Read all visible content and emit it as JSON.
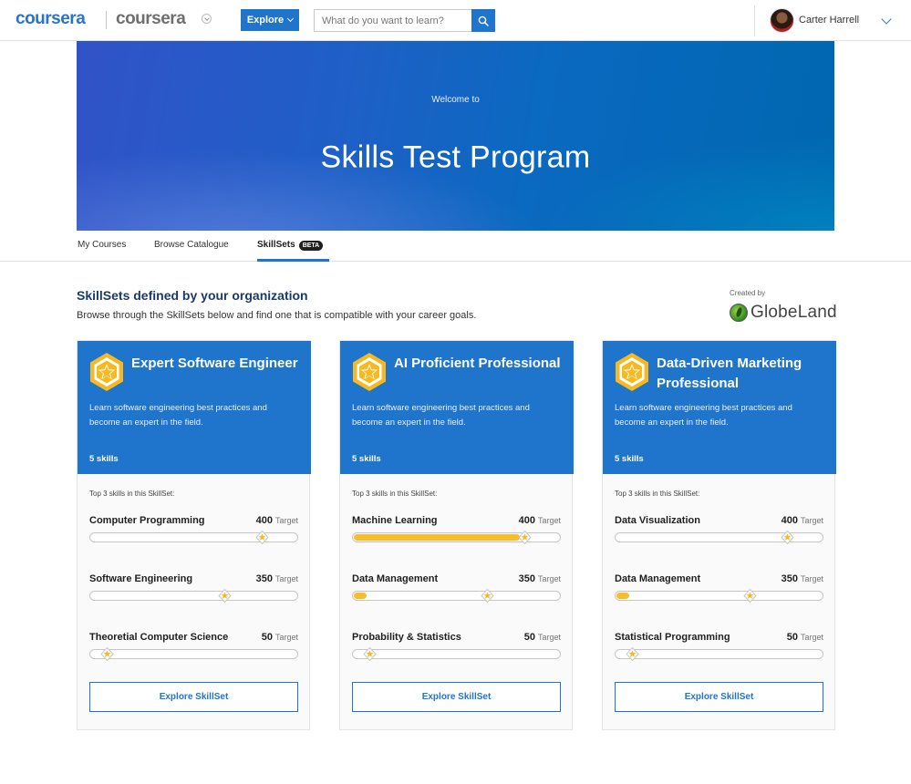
{
  "header": {
    "logo_primary": "coursera",
    "logo_secondary": "coursera",
    "explore_label": "Explore",
    "search_placeholder": "What do you want to learn?",
    "user_name": "Carter Harrell"
  },
  "hero": {
    "welcome": "Welcome to",
    "title": "Skills Test Program"
  },
  "tabs": [
    {
      "label": "My Courses"
    },
    {
      "label": "Browse Catalogue"
    },
    {
      "label": "SkillSets",
      "badge": "BETA",
      "active": true
    }
  ],
  "section": {
    "title": "SkillSets defined by your organization",
    "subtitle": "Browse through the SkillSets below and find one that is compatible with your career goals.",
    "created_by": "Created by",
    "org_name": "GlobeLand"
  },
  "cards": [
    {
      "title": "Expert Software Engineer",
      "description": "Learn software engineering best practices and become an expert in the field.",
      "skill_count": "5 skills",
      "top3_label": "Top 3 skills in this SkillSet:",
      "target_unit": "Target",
      "button_label": "Explore SkillSet",
      "skills": [
        {
          "name": "Computer Programming",
          "target": "400",
          "progress": 0.0,
          "target_pct": 0.82
        },
        {
          "name": "Software Engineering",
          "target": "350",
          "progress": 0.0,
          "target_pct": 0.64
        },
        {
          "name": "Theoretial Computer Science",
          "target": "50",
          "progress": 0.0,
          "target_pct": 0.08
        }
      ]
    },
    {
      "title": "AI Proficient Professional",
      "description": "Learn software engineering best practices and become an expert in the field.",
      "skill_count": "5 skills",
      "top3_label": "Top 3 skills in this SkillSet:",
      "target_unit": "Target",
      "button_label": "Explore SkillSet",
      "skills": [
        {
          "name": "Machine Learning",
          "target": "400",
          "progress": 0.8,
          "target_pct": 0.82
        },
        {
          "name": "Data Management",
          "target": "350",
          "progress": 0.06,
          "target_pct": 0.64
        },
        {
          "name": "Probability & Statistics",
          "target": "50",
          "progress": 0.0,
          "target_pct": 0.08
        }
      ]
    },
    {
      "title": "Data-Driven Marketing Professional",
      "description": "Learn software engineering best practices and become an expert in the field.",
      "skill_count": "5 skills",
      "top3_label": "Top 3 skills in this SkillSet:",
      "target_unit": "Target",
      "button_label": "Explore SkillSet",
      "skills": [
        {
          "name": "Data Visualization",
          "target": "400",
          "progress": 0.0,
          "target_pct": 0.82
        },
        {
          "name": "Data Management",
          "target": "350",
          "progress": 0.06,
          "target_pct": 0.64
        },
        {
          "name": "Statistical Programming",
          "target": "50",
          "progress": 0.0,
          "target_pct": 0.08
        }
      ]
    }
  ],
  "colors": {
    "brand_blue": "#1f74cc",
    "progress_yellow": "#f5be2d",
    "badge_gold": "#f5b921"
  }
}
